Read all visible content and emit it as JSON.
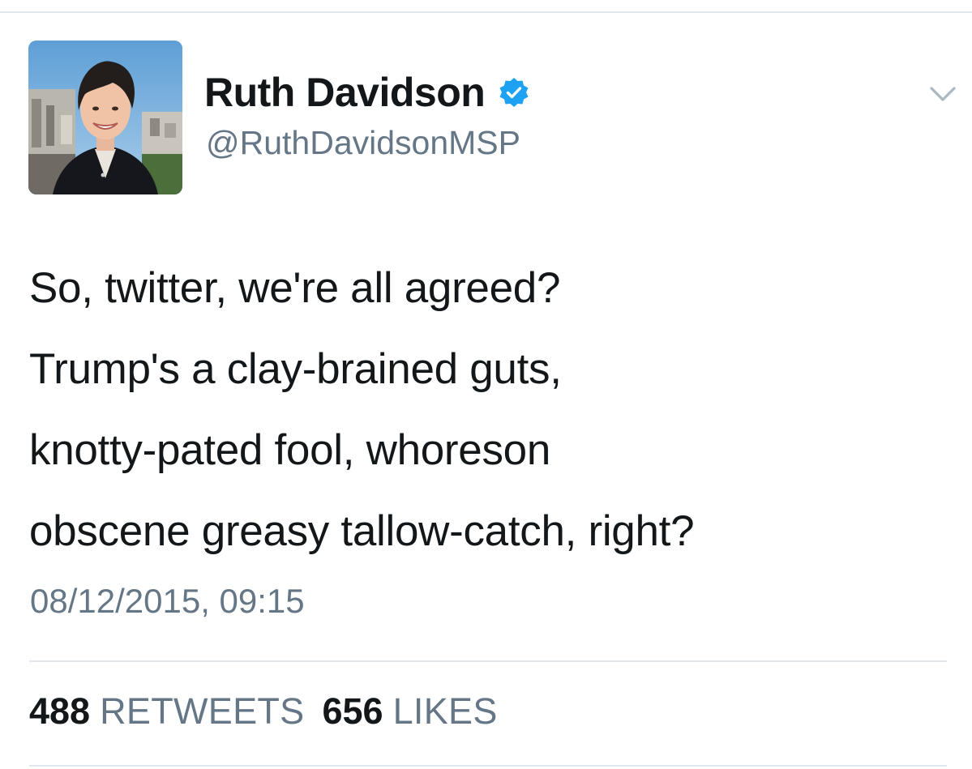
{
  "tweet": {
    "author": {
      "display_name": "Ruth Davidson",
      "handle": "@RuthDavidsonMSP",
      "verified": true,
      "avatar_icon": "profile-photo"
    },
    "text_lines": [
      "So, twitter, we're all agreed?",
      "Trump's a clay-brained guts,",
      "knotty-pated fool, whoreson",
      "obscene greasy tallow-catch, right?"
    ],
    "timestamp": "08/12/2015, 09:15",
    "stats": {
      "retweets": {
        "count": "488",
        "label": "RETWEETS"
      },
      "likes": {
        "count": "656",
        "label": "LIKES"
      }
    },
    "menu_icon": "chevron-down-icon"
  },
  "colors": {
    "text_primary": "#14171a",
    "text_secondary": "#657786",
    "verified_blue": "#1da1f2",
    "divider": "#e1e8ed"
  }
}
